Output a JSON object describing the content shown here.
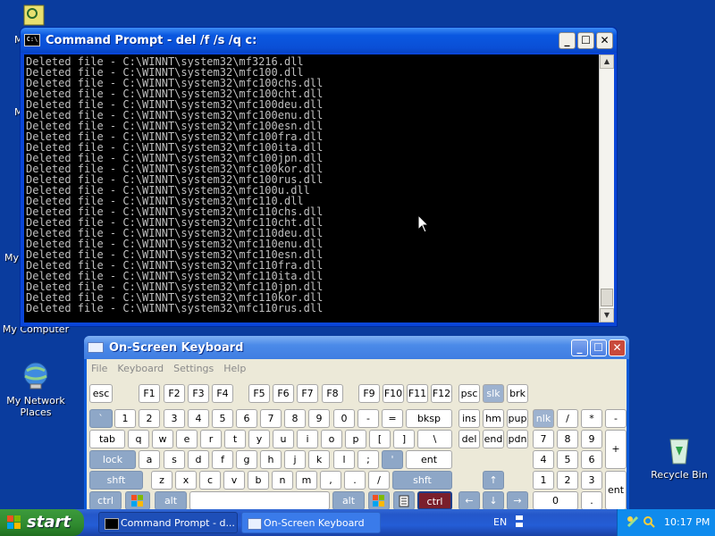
{
  "desktop": {
    "icons": {
      "my_computer": "My Computer",
      "my_network_places": "My Network Places",
      "recycle_bin": "Recycle Bin"
    },
    "partial_labels": {
      "my": "My",
      "m1": "M",
      "m2": "M"
    }
  },
  "cmd_window": {
    "title": "Command Prompt - del /f /s /q c:",
    "buttons": {
      "minimize": "_",
      "maximize": "☐",
      "close": "✕"
    },
    "lines": [
      "Deleted file - C:\\WINNT\\system32\\mf3216.dll",
      "Deleted file - C:\\WINNT\\system32\\mfc100.dll",
      "Deleted file - C:\\WINNT\\system32\\mfc100chs.dll",
      "Deleted file - C:\\WINNT\\system32\\mfc100cht.dll",
      "Deleted file - C:\\WINNT\\system32\\mfc100deu.dll",
      "Deleted file - C:\\WINNT\\system32\\mfc100enu.dll",
      "Deleted file - C:\\WINNT\\system32\\mfc100esn.dll",
      "Deleted file - C:\\WINNT\\system32\\mfc100fra.dll",
      "Deleted file - C:\\WINNT\\system32\\mfc100ita.dll",
      "Deleted file - C:\\WINNT\\system32\\mfc100jpn.dll",
      "Deleted file - C:\\WINNT\\system32\\mfc100kor.dll",
      "Deleted file - C:\\WINNT\\system32\\mfc100rus.dll",
      "Deleted file - C:\\WINNT\\system32\\mfc100u.dll",
      "Deleted file - C:\\WINNT\\system32\\mfc110.dll",
      "Deleted file - C:\\WINNT\\system32\\mfc110chs.dll",
      "Deleted file - C:\\WINNT\\system32\\mfc110cht.dll",
      "Deleted file - C:\\WINNT\\system32\\mfc110deu.dll",
      "Deleted file - C:\\WINNT\\system32\\mfc110enu.dll",
      "Deleted file - C:\\WINNT\\system32\\mfc110esn.dll",
      "Deleted file - C:\\WINNT\\system32\\mfc110fra.dll",
      "Deleted file - C:\\WINNT\\system32\\mfc110ita.dll",
      "Deleted file - C:\\WINNT\\system32\\mfc110jpn.dll",
      "Deleted file - C:\\WINNT\\system32\\mfc110kor.dll",
      "Deleted file - C:\\WINNT\\system32\\mfc110rus.dll"
    ]
  },
  "osk": {
    "title": "On-Screen Keyboard",
    "menu": [
      "File",
      "Keyboard",
      "Settings",
      "Help"
    ],
    "keys": {
      "esc": "esc",
      "f1": "F1",
      "f2": "F2",
      "f3": "F3",
      "f4": "F4",
      "f5": "F5",
      "f6": "F6",
      "f7": "F7",
      "f8": "F8",
      "f9": "F9",
      "f10": "F10",
      "f11": "F11",
      "f12": "F12",
      "psc": "psc",
      "slk": "slk",
      "brk": "brk",
      "grave": "`",
      "n1": "1",
      "n2": "2",
      "n3": "3",
      "n4": "4",
      "n5": "5",
      "n6": "6",
      "n7": "7",
      "n8": "8",
      "n9": "9",
      "n0": "0",
      "minus": "-",
      "equal": "=",
      "bksp": "bksp",
      "ins": "ins",
      "hm": "hm",
      "pup": "pup",
      "nlk": "nlk",
      "div": "/",
      "mul": "*",
      "sub": "-",
      "tab": "tab",
      "q": "q",
      "w": "w",
      "e": "e",
      "r": "r",
      "t": "t",
      "y": "y",
      "u": "u",
      "i": "i",
      "o": "o",
      "p": "p",
      "lbr": "[",
      "rbr": "]",
      "bslash": "\\",
      "del": "del",
      "end": "end",
      "pdn": "pdn",
      "np7": "7",
      "np8": "8",
      "np9": "9",
      "add": "+",
      "lock": "lock",
      "a": "a",
      "s": "s",
      "d": "d",
      "f": "f",
      "g": "g",
      "h": "h",
      "j": "j",
      "k": "k",
      "l": "l",
      "semi": ";",
      "quote": "'",
      "ent": "ent",
      "np4": "4",
      "np5": "5",
      "np6": "6",
      "shft": "shft",
      "z": "z",
      "x": "x",
      "c": "c",
      "v": "v",
      "b": "b",
      "n": "n",
      "m": "m",
      "comma": ",",
      "dot": ".",
      "slash": "/",
      "shft2": "shft",
      "up": "↑",
      "np1": "1",
      "np2": "2",
      "np3": "3",
      "npent": "ent",
      "ctrl": "ctrl",
      "alt": "alt",
      "alt2": "alt",
      "ctrl2": "ctrl",
      "left": "←",
      "down": "↓",
      "right": "→",
      "np0": "0",
      "npdot": "."
    }
  },
  "taskbar": {
    "start": "start",
    "tasks": [
      "Command Prompt - d...",
      "On-Screen Keyboard"
    ],
    "lang": "EN",
    "clock": "10:17 PM"
  },
  "colors": {
    "desktop": "#0a3c9e",
    "taskbar": "#245dd6",
    "start": "#2f8a2f",
    "active_key": "#7a1f2c"
  }
}
